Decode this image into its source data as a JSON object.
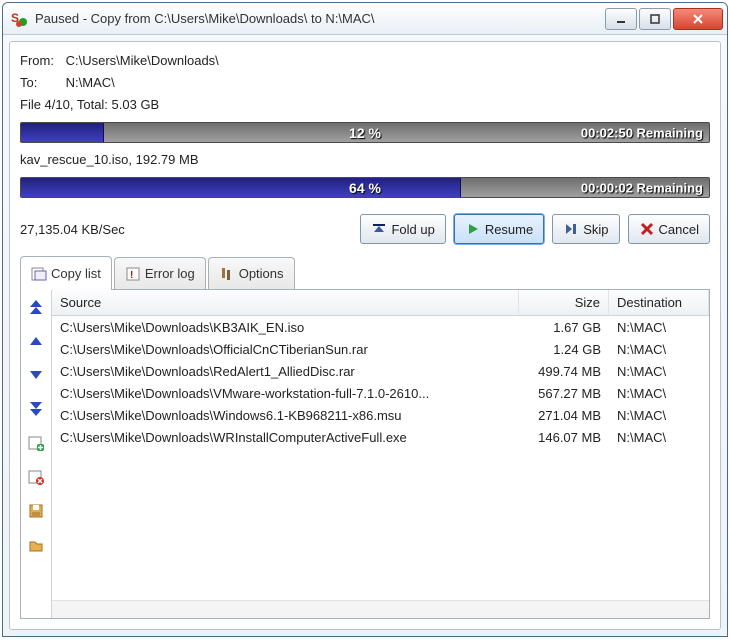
{
  "title": "Paused - Copy from C:\\Users\\Mike\\Downloads\\ to N:\\MAC\\",
  "from_label": "From:",
  "to_label": "To:",
  "from_path": "C:\\Users\\Mike\\Downloads\\",
  "to_path": "N:\\MAC\\",
  "total_line": "File 4/10, Total: 5.03 GB",
  "progress_total": {
    "percent": 12,
    "percent_text": "12 %",
    "remaining": "00:02:50 Remaining"
  },
  "current_file": "kav_rescue_10.iso, 192.79 MB",
  "progress_file": {
    "percent": 64,
    "percent_text": "64 %",
    "remaining": "00:00:02 Remaining"
  },
  "speed": "27,135.04 KB/Sec",
  "buttons": {
    "foldup": "Fold up",
    "resume": "Resume",
    "skip": "Skip",
    "cancel": "Cancel"
  },
  "tabs": {
    "copylist": "Copy list",
    "errorlog": "Error log",
    "options": "Options"
  },
  "columns": {
    "source": "Source",
    "size": "Size",
    "destination": "Destination"
  },
  "rows": [
    {
      "source": "C:\\Users\\Mike\\Downloads\\KB3AIK_EN.iso",
      "size": "1.67 GB",
      "dest": "N:\\MAC\\"
    },
    {
      "source": "C:\\Users\\Mike\\Downloads\\OfficialCnCTiberianSun.rar",
      "size": "1.24 GB",
      "dest": "N:\\MAC\\"
    },
    {
      "source": "C:\\Users\\Mike\\Downloads\\RedAlert1_AlliedDisc.rar",
      "size": "499.74 MB",
      "dest": "N:\\MAC\\"
    },
    {
      "source": "C:\\Users\\Mike\\Downloads\\VMware-workstation-full-7.1.0-2610...",
      "size": "567.27 MB",
      "dest": "N:\\MAC\\"
    },
    {
      "source": "C:\\Users\\Mike\\Downloads\\Windows6.1-KB968211-x86.msu",
      "size": "271.04 MB",
      "dest": "N:\\MAC\\"
    },
    {
      "source": "C:\\Users\\Mike\\Downloads\\WRInstallComputerActiveFull.exe",
      "size": "146.07 MB",
      "dest": "N:\\MAC\\"
    }
  ]
}
